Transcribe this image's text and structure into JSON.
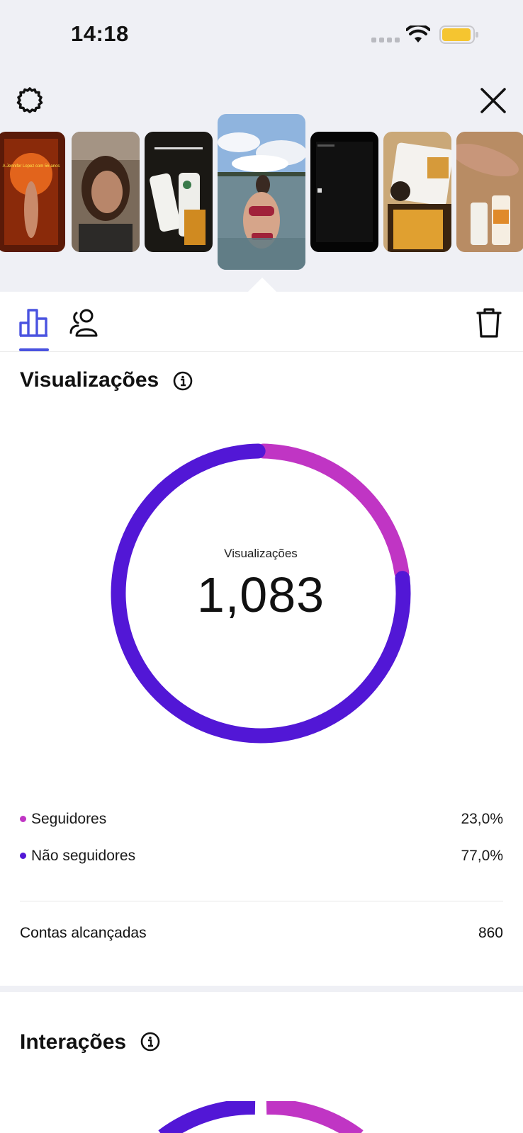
{
  "status_bar": {
    "time": "14:18"
  },
  "stories": [
    {
      "id": "story-1",
      "overlay": "A Jennifer Lopez com 56 anos"
    },
    {
      "id": "story-2",
      "overlay": ""
    },
    {
      "id": "story-3",
      "overlay": ""
    },
    {
      "id": "story-4",
      "overlay": "",
      "selected": true
    },
    {
      "id": "story-5",
      "overlay": ""
    },
    {
      "id": "story-6",
      "overlay": ""
    },
    {
      "id": "story-7",
      "overlay": ""
    }
  ],
  "tabs": [
    {
      "name": "insights",
      "icon": "bar-chart-icon",
      "active": true
    },
    {
      "name": "audience",
      "icon": "audience-icon",
      "active": false
    }
  ],
  "views_section": {
    "title": "Visualizações",
    "center_label": "Visualizações",
    "center_value": "1,083",
    "legend": [
      {
        "label": "Seguidores",
        "percent": "23,0%",
        "color": "#c035c4"
      },
      {
        "label": "Não seguidores",
        "percent": "77,0%",
        "color": "#5217d6"
      }
    ],
    "reach_label": "Contas alcançadas",
    "reach_value": "860"
  },
  "chart_data": {
    "type": "pie",
    "title": "Visualizações",
    "categories": [
      "Seguidores",
      "Não seguidores"
    ],
    "values": [
      23.0,
      77.0
    ]
  },
  "interactions_section": {
    "title": "Interações"
  },
  "colors": {
    "followers": "#c035c4",
    "non_followers": "#5217d6",
    "accent": "#4a53e0"
  }
}
